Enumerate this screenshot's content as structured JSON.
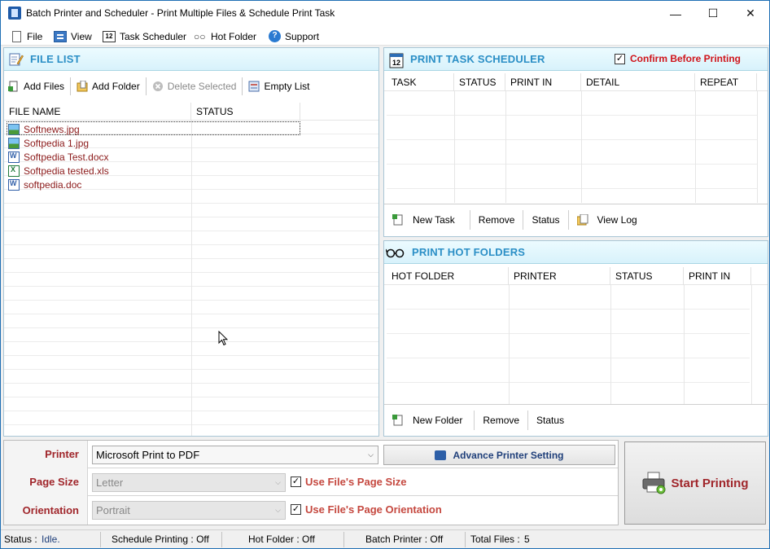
{
  "window": {
    "title": "Batch Printer and Scheduler - Print Multiple Files & Schedule Print Task",
    "minimize": "—",
    "maximize": "☐",
    "close": "✕"
  },
  "menu": {
    "items": [
      {
        "label": "File",
        "icon": "file-icon"
      },
      {
        "label": "View",
        "icon": "view-icon"
      },
      {
        "label": "Task Scheduler",
        "icon": "calendar-icon"
      },
      {
        "label": "Hot Folder",
        "icon": "glasses-icon"
      },
      {
        "label": "Support",
        "icon": "help-icon"
      }
    ]
  },
  "file_list": {
    "title": "FILE LIST",
    "toolbar": {
      "add_files": "Add Files",
      "add_folder": "Add Folder",
      "delete_selected": "Delete Selected",
      "empty_list": "Empty List"
    },
    "columns": [
      "FILE NAME",
      "STATUS"
    ],
    "files": [
      {
        "name": "Softnews.jpg",
        "type": "image",
        "status": ""
      },
      {
        "name": "Softpedia 1.jpg",
        "type": "image",
        "status": ""
      },
      {
        "name": "Softpedia Test.docx",
        "type": "word",
        "status": ""
      },
      {
        "name": "Softpedia tested.xls",
        "type": "excel",
        "status": ""
      },
      {
        "name": "softpedia.doc",
        "type": "word",
        "status": ""
      }
    ]
  },
  "scheduler": {
    "title": "PRINT TASK SCHEDULER",
    "confirm_label": "Confirm Before Printing",
    "confirm_checked": true,
    "calendar_day": "12",
    "columns": [
      "TASK",
      "STATUS",
      "PRINT IN",
      "DETAIL",
      "REPEAT"
    ],
    "buttons": {
      "new_task": "New Task",
      "remove": "Remove",
      "status": "Status",
      "view_log": "View Log"
    }
  },
  "hot_folders": {
    "title": "PRINT HOT FOLDERS",
    "columns": [
      "HOT FOLDER",
      "PRINTER",
      "STATUS",
      "PRINT IN"
    ],
    "buttons": {
      "new_folder": "New Folder",
      "remove": "Remove",
      "status": "Status"
    }
  },
  "settings": {
    "printer_label": "Printer",
    "printer_value": "Microsoft Print to PDF",
    "advance_setting": "Advance Printer Setting",
    "page_size_label": "Page Size",
    "page_size_value": "Letter",
    "use_page_size": "Use File's Page Size",
    "use_page_size_checked": true,
    "orientation_label": "Orientation",
    "orientation_value": "Portrait",
    "use_orientation": "Use File's Page Orientation",
    "use_orientation_checked": true,
    "check_mark": "✓"
  },
  "start_button": {
    "label": "Start Printing"
  },
  "status_bar": {
    "status_label": "Status :",
    "status_value": "Idle.",
    "schedule": "Schedule Printing : Off",
    "hot_folder": "Hot Folder : Off",
    "batch": "Batch Printer : Off",
    "total_label": "Total Files :",
    "total_value": "5"
  },
  "colors": {
    "accent_title": "#2b8fc6",
    "label_red": "#a0262b",
    "file_text": "#8b1a1a",
    "confirm_red": "#d0141a"
  }
}
